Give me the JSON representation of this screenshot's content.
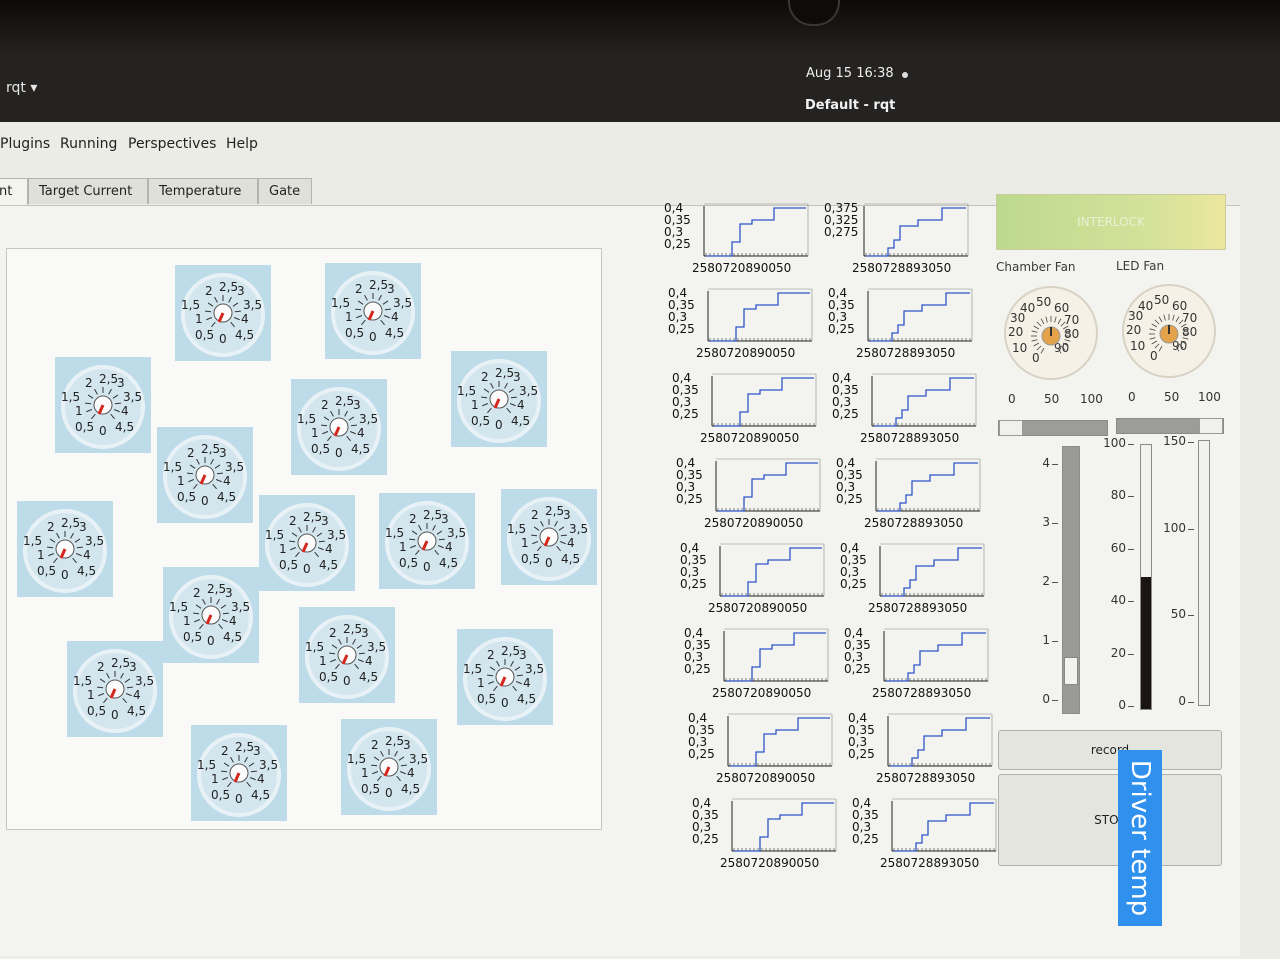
{
  "system": {
    "apps_menu": "rqt ▾",
    "clock": "Aug 15  16:38",
    "window_title": "Default - rqt"
  },
  "menu": [
    "Plugins",
    "Running",
    "Perspectives",
    "Help"
  ],
  "tabs": [
    {
      "label": "nt",
      "active": true
    },
    {
      "label": "Target Current",
      "active": false
    },
    {
      "label": "Temperature",
      "active": false
    },
    {
      "label": "Gate",
      "active": false
    }
  ],
  "dial_labels": [
    "0,5",
    "0",
    "4,5",
    "1",
    "4",
    "1,5",
    "3,5",
    "2",
    "2,5",
    "3"
  ],
  "dial_count": 16,
  "plots": {
    "y_ticks_a": [
      "0,4",
      "0,35",
      "0,3",
      "0,25"
    ],
    "y_ticks_b": [
      "0,375",
      "0,325",
      "0,275"
    ],
    "x_ticks": "2580720890050",
    "x_ticks_b": "2580728893050"
  },
  "interlock": {
    "label": "INTERLOCK",
    "color": "#c7dc92"
  },
  "chamber_fan": {
    "label": "Chamber Fan",
    "gauge_ticks": [
      "10",
      "20",
      "30",
      "40",
      "50",
      "60",
      "70",
      "80",
      "90"
    ],
    "gauge_zero": "0",
    "gauge_value": 50,
    "slider_ticks": [
      "0",
      "50",
      "100"
    ],
    "slider_value": 0
  },
  "led_fan": {
    "label": "LED Fan",
    "gauge_ticks": [
      "10",
      "20",
      "30",
      "40",
      "50",
      "60",
      "70",
      "80",
      "90"
    ],
    "gauge_zero": "0",
    "gauge_value": 50,
    "slider_ticks": [
      "0",
      "50",
      "100"
    ],
    "slider_value": 100
  },
  "vslider": {
    "ticks": [
      "4",
      "3",
      "2",
      "1",
      "0"
    ],
    "value": 0.3
  },
  "bar_100": {
    "ticks": [
      "100",
      "80",
      "60",
      "40",
      "20",
      "0"
    ],
    "value": 50
  },
  "bar_150": {
    "ticks": [
      "150",
      "100",
      "50",
      "0"
    ],
    "value": 0
  },
  "buttons": {
    "record": "record",
    "stop": "STOP"
  },
  "overlay": {
    "text": "Driver temp",
    "color": "#2f90ee"
  }
}
